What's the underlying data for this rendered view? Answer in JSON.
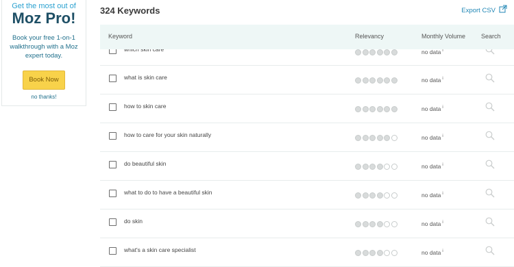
{
  "promo": {
    "tagline": "Get the most out of",
    "brand": "Moz Pro!",
    "description": "Book your free 1-on-1 walkthrough with a Moz expert today.",
    "button_label": "Book Now",
    "dismiss_label": "no thanks!"
  },
  "header": {
    "title": "324 Keywords",
    "export_label": "Export CSV",
    "export_icon": "external-link-icon"
  },
  "table": {
    "columns": {
      "keyword": "Keyword",
      "relevancy": "Relevancy",
      "volume": "Monthly Volume",
      "search": "Search"
    },
    "rows": [
      {
        "keyword": "which skin care",
        "relevancy": 6,
        "volume": "no data"
      },
      {
        "keyword": "what is skin care",
        "relevancy": 6,
        "volume": "no data"
      },
      {
        "keyword": "how to skin care",
        "relevancy": 6,
        "volume": "no data"
      },
      {
        "keyword": "how to care for your skin naturally",
        "relevancy": 5,
        "volume": "no data"
      },
      {
        "keyword": "do beautiful skin",
        "relevancy": 4,
        "volume": "no data"
      },
      {
        "keyword": "what to do to have a beautiful skin",
        "relevancy": 4,
        "volume": "no data"
      },
      {
        "keyword": "do skin",
        "relevancy": 4,
        "volume": "no data"
      },
      {
        "keyword": "what's a skin care specialist",
        "relevancy": 4,
        "volume": "no data"
      }
    ],
    "relevancy_max": 6,
    "info_marker": "i"
  },
  "colors": {
    "accent": "#1f86b5",
    "brand": "#1f5066",
    "button": "#f8d24a",
    "header_bg": "#eef7f6"
  }
}
